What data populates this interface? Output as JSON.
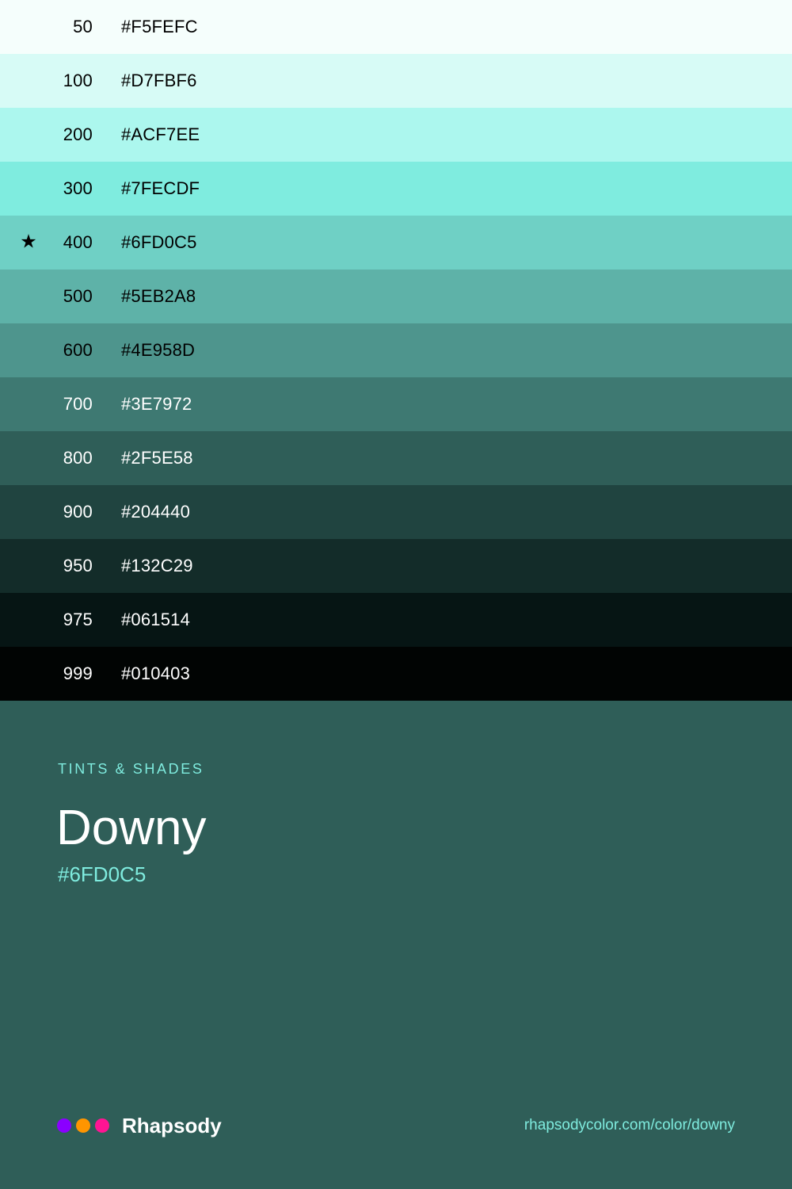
{
  "swatches": [
    {
      "step": "50",
      "hex": "#F5FEFC",
      "bg": "#F5FEFC",
      "fg": "#000000",
      "starred": false
    },
    {
      "step": "100",
      "hex": "#D7FBF6",
      "bg": "#D7FBF6",
      "fg": "#000000",
      "starred": false
    },
    {
      "step": "200",
      "hex": "#ACF7EE",
      "bg": "#ACF7EE",
      "fg": "#000000",
      "starred": false
    },
    {
      "step": "300",
      "hex": "#7FECDF",
      "bg": "#7FECDF",
      "fg": "#000000",
      "starred": false
    },
    {
      "step": "400",
      "hex": "#6FD0C5",
      "bg": "#6FD0C5",
      "fg": "#000000",
      "starred": true
    },
    {
      "step": "500",
      "hex": "#5EB2A8",
      "bg": "#5EB2A8",
      "fg": "#000000",
      "starred": false
    },
    {
      "step": "600",
      "hex": "#4E958D",
      "bg": "#4E958D",
      "fg": "#000000",
      "starred": false
    },
    {
      "step": "700",
      "hex": "#3E7972",
      "bg": "#3E7972",
      "fg": "#FFFFFF",
      "starred": false
    },
    {
      "step": "800",
      "hex": "#2F5E58",
      "bg": "#2F5E58",
      "fg": "#FFFFFF",
      "starred": false
    },
    {
      "step": "900",
      "hex": "#204440",
      "bg": "#204440",
      "fg": "#FFFFFF",
      "starred": false
    },
    {
      "step": "950",
      "hex": "#132C29",
      "bg": "#132C29",
      "fg": "#FFFFFF",
      "starred": false
    },
    {
      "step": "975",
      "hex": "#061514",
      "bg": "#061514",
      "fg": "#FFFFFF",
      "starred": false
    },
    {
      "step": "999",
      "hex": "#010403",
      "bg": "#010403",
      "fg": "#FFFFFF",
      "starred": false
    }
  ],
  "star_glyph": "★",
  "info": {
    "eyebrow": "TINTS & SHADES",
    "name": "Downy",
    "hex": "#6FD0C5"
  },
  "footer": {
    "brand": "Rhapsody",
    "url": "rhapsodycolor.com/color/downy",
    "dot_colors": [
      "#8A00FF",
      "#FF9500",
      "#FF1493"
    ]
  },
  "colors": {
    "panel_bg": "#2F5E58",
    "accent": "#7FECDF"
  }
}
